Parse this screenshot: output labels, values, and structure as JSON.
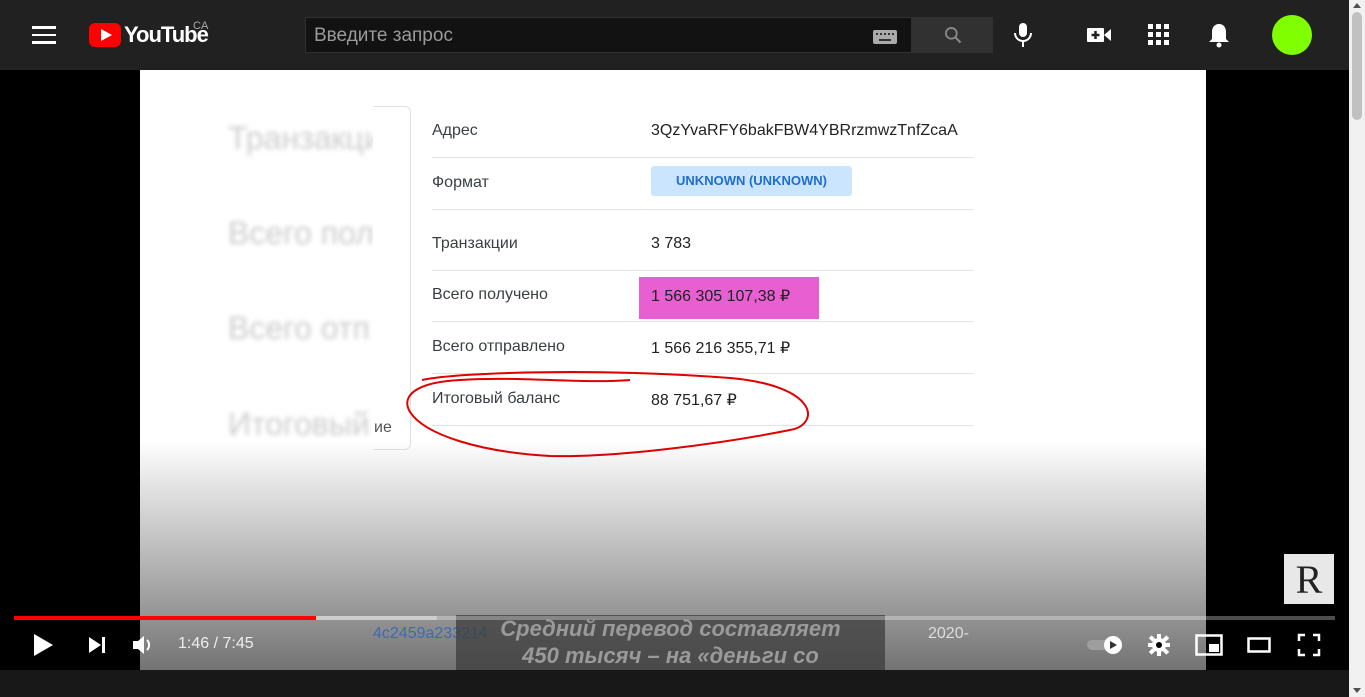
{
  "header": {
    "logo_text": "YouTube",
    "region": "CA",
    "search_placeholder": "Введите запрос",
    "icons": [
      "menu-icon",
      "keyboard-icon",
      "search-icon",
      "mic-icon",
      "create-video-icon",
      "apps-icon",
      "notifications-icon"
    ],
    "avatar_color": "#7fff00"
  },
  "video": {
    "blurred_labels": [
      "Транзакци",
      "Всего пол",
      "Всего отп",
      "Итоговый"
    ],
    "edge_text": "ие",
    "table": [
      {
        "label": "Адрес",
        "value": "3QzYvaRFY6bakFBW4YBRrzmwzTnfZcaA"
      },
      {
        "label": "Формат",
        "badge": "UNKNOWN (UNKNOWN)"
      },
      {
        "label": "Транзакции",
        "value": "3 783"
      },
      {
        "label": "Всего получено",
        "value": "1 566 305 107,38 ₽"
      },
      {
        "label": "Всего отправлено",
        "value": "1 566 216 355,71 ₽"
      },
      {
        "label": "Итоговый баланс",
        "value": "88 751,67 ₽"
      }
    ],
    "highlight_color": "#e75fd0",
    "circle_color": "#e00000",
    "subtitle_line1": "Средний перевод составляет",
    "subtitle_line2": "450 тысяч – на «деньги со",
    "under_left": "4c2459a233214",
    "under_right": "2020-",
    "channel_logo": "R"
  },
  "player": {
    "progress": 0.2283,
    "buffered": 0.32,
    "time_current": "1:46",
    "time_total": "7:45",
    "time_display": "1:46 / 7:45",
    "accent": "#ff0000"
  }
}
